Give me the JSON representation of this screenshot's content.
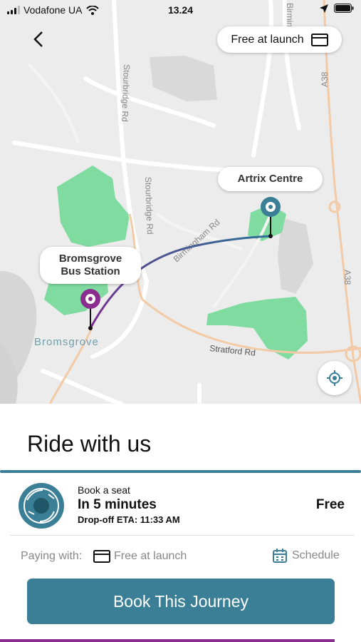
{
  "status_bar": {
    "carrier": "Vodafone UA",
    "time": "13.24"
  },
  "header": {
    "fare_label": "Free at launch"
  },
  "map": {
    "road_labels": [
      "Stourbridge Rd",
      "Stourbridge Rd",
      "Birmingham Rd",
      "Stratford Rd",
      "A38",
      "A38",
      "Birmin"
    ],
    "town_label": "Bromsgrove",
    "origin": {
      "name_line1": "Bromsgrove",
      "name_line2": "Bus Station",
      "color": "#8b2d8f"
    },
    "destination": {
      "name": "Artrix Centre",
      "color": "#3a7f96"
    },
    "park_color": "#7fdba0"
  },
  "sheet": {
    "title": "Ride with us",
    "ride": {
      "subtitle": "Book a seat",
      "headline": "In 5 minutes",
      "eta": "Drop-off ETA: 11:33 AM",
      "price": "Free"
    },
    "payment": {
      "label": "Paying with:",
      "value": "Free at launch"
    },
    "schedule_label": "Schedule",
    "book_button": "Book This Journey"
  },
  "colors": {
    "accent": "#3a7f96",
    "secondary": "#8b2d8f"
  }
}
